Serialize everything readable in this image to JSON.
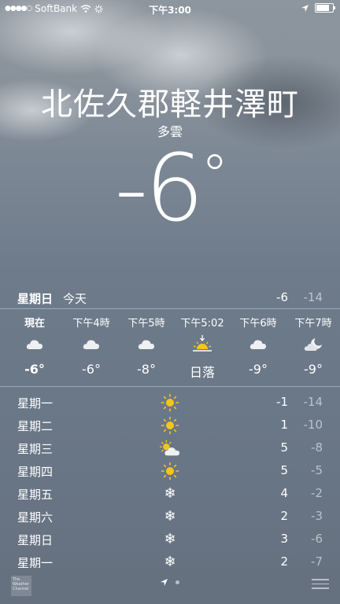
{
  "status_bar": {
    "signal": "●●●●○",
    "carrier": "SoftBank",
    "time": "下午3:00",
    "battery_level": 0.9
  },
  "location": {
    "city": "北佐久郡軽井澤町",
    "condition": "多雲",
    "temperature": "-6",
    "degree_symbol": "°"
  },
  "today": {
    "day": "星期日",
    "label": "今天",
    "high": "-6",
    "low": "-14"
  },
  "hourly": [
    {
      "time": "現在",
      "icon": "cloud-icon",
      "temp": "-6°"
    },
    {
      "time": "下午4時",
      "icon": "cloud-icon",
      "temp": "-6°"
    },
    {
      "time": "下午5時",
      "icon": "cloud-icon",
      "temp": "-8°"
    },
    {
      "time": "下午5:02",
      "icon": "sunset-icon",
      "temp": "日落"
    },
    {
      "time": "下午6時",
      "icon": "cloud-icon",
      "temp": "-9°"
    },
    {
      "time": "下午7時",
      "icon": "moon-cloud-icon",
      "temp": "-9°"
    }
  ],
  "daily": [
    {
      "day": "星期一",
      "icon": "sun-icon",
      "high": "-1",
      "low": "-14"
    },
    {
      "day": "星期二",
      "icon": "sun-icon",
      "high": "1",
      "low": "-10"
    },
    {
      "day": "星期三",
      "icon": "partly-cloudy-icon",
      "high": "5",
      "low": "-8"
    },
    {
      "day": "星期四",
      "icon": "sun-icon",
      "high": "5",
      "low": "-5"
    },
    {
      "day": "星期五",
      "icon": "snow-icon",
      "high": "4",
      "low": "-2"
    },
    {
      "day": "星期六",
      "icon": "snow-icon",
      "high": "2",
      "low": "-3"
    },
    {
      "day": "星期日",
      "icon": "snow-icon",
      "high": "3",
      "low": "-6"
    },
    {
      "day": "星期一",
      "icon": "snow-icon",
      "high": "2",
      "low": "-7"
    }
  ],
  "bottom_bar": {
    "logo_text": "The Weather Channel",
    "snow_glyph": "❄"
  }
}
